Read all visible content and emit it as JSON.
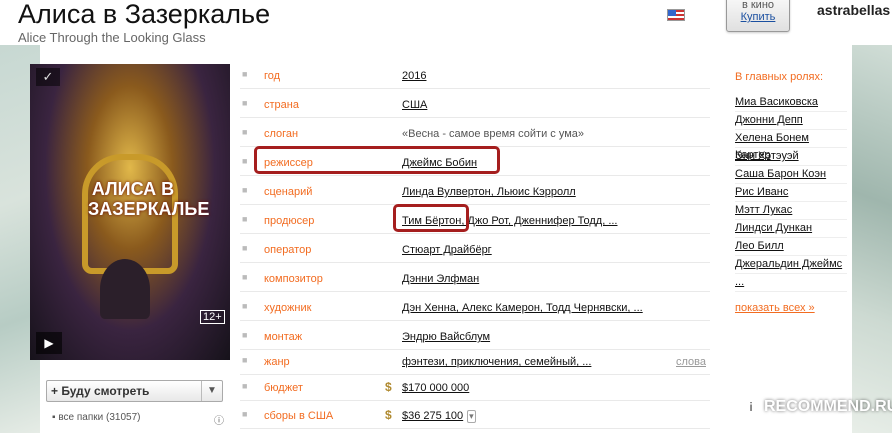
{
  "header": {
    "title": "Алиса в Зазеркалье",
    "subtitle": "Alice Through the Looking Glass",
    "buy_top": "в кино",
    "buy_label": "Купить",
    "username": "astrabellas"
  },
  "poster": {
    "title": "АЛИСА В ЗАЗЕРКАЛЬЕ",
    "age_rating": "12+"
  },
  "watch": {
    "label": "+ Буду смотреть",
    "folders": "все папки (31057)"
  },
  "info": [
    {
      "label": "год",
      "value": "2016"
    },
    {
      "label": "страна",
      "value": "США"
    },
    {
      "label": "слоган",
      "value": "«Весна - самое время сойти с ума»"
    },
    {
      "label": "режиссер",
      "value": "Джеймс Бобин"
    },
    {
      "label": "сценарий",
      "value": "Линда Вулвертон, Льюис Кэрролл"
    },
    {
      "label": "продюсер",
      "value": "Тим Бёртон, Джо Рот, Дженнифер Тодд, ..."
    },
    {
      "label": "оператор",
      "value": "Стюарт Драйбёрг"
    },
    {
      "label": "композитор",
      "value": "Дэнни Элфман"
    },
    {
      "label": "художник",
      "value": "Дэн Хенна, Алекс Камерон, Тодд Чернявски, ..."
    },
    {
      "label": "монтаж",
      "value": "Эндрю Вайсблум"
    },
    {
      "label": "жанр",
      "value": "фэнтези, приключения, семейный, ...",
      "extra": "слова"
    },
    {
      "label": "бюджет",
      "value": "$170 000 000"
    },
    {
      "label": "сборы в США",
      "value": "$36 275 100"
    }
  ],
  "cast": {
    "title": "В главных ролях:",
    "actors": [
      "Миа Васиковска",
      "Джонни Депп",
      "Хелена Бонем Картер",
      "Энн Хэтэуэй",
      "Саша Барон Коэн",
      "Рис Иванс",
      "Мэтт Лукас",
      "Линдси Дункан",
      "Лео Билл",
      "Джеральдин Джеймс",
      "..."
    ],
    "show_all": "показать всех »"
  },
  "watermark": "RECOMMEND.RU",
  "colors": {
    "label": "#f26c21",
    "highlight": "#a51e1e",
    "link": "#1a4fa0"
  }
}
